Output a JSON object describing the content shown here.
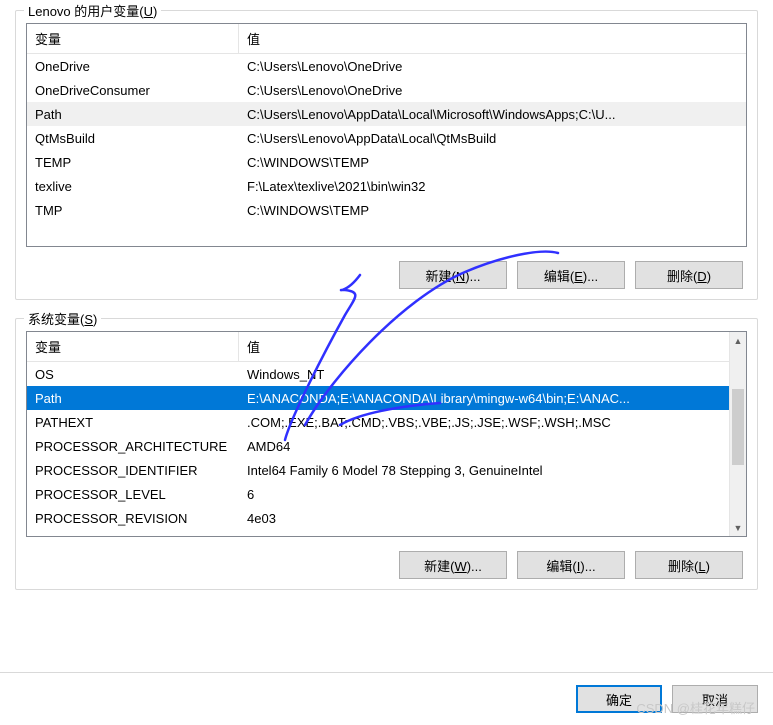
{
  "user_section": {
    "label_prefix": "Lenovo 的用户变量(",
    "label_key": "U",
    "label_suffix": ")",
    "headers": {
      "name": "变量",
      "value": "值"
    },
    "rows": [
      {
        "name": "OneDrive",
        "value": "C:\\Users\\Lenovo\\OneDrive",
        "selected": false
      },
      {
        "name": "OneDriveConsumer",
        "value": "C:\\Users\\Lenovo\\OneDrive",
        "selected": false
      },
      {
        "name": "Path",
        "value": "C:\\Users\\Lenovo\\AppData\\Local\\Microsoft\\WindowsApps;C:\\U...",
        "selected": "light"
      },
      {
        "name": "QtMsBuild",
        "value": "C:\\Users\\Lenovo\\AppData\\Local\\QtMsBuild",
        "selected": false
      },
      {
        "name": "TEMP",
        "value": "C:\\WINDOWS\\TEMP",
        "selected": false
      },
      {
        "name": "texlive",
        "value": "F:\\Latex\\texlive\\2021\\bin\\win32",
        "selected": false
      },
      {
        "name": "TMP",
        "value": "C:\\WINDOWS\\TEMP",
        "selected": false
      }
    ],
    "buttons": {
      "new": {
        "label": "新建(",
        "key": "N",
        "suffix": ")..."
      },
      "edit": {
        "label": "编辑(",
        "key": "E",
        "suffix": ")..."
      },
      "delete": {
        "label": "删除(",
        "key": "D",
        "suffix": ")"
      }
    }
  },
  "system_section": {
    "label_prefix": "系统变量(",
    "label_key": "S",
    "label_suffix": ")",
    "headers": {
      "name": "变量",
      "value": "值"
    },
    "rows": [
      {
        "name": "OS",
        "value": "Windows_NT",
        "selected": false
      },
      {
        "name": "Path",
        "value": "E:\\ANACONDA;E:\\ANACONDA\\Library\\mingw-w64\\bin;E:\\ANAC...",
        "selected": true
      },
      {
        "name": "PATHEXT",
        "value": ".COM;.EXE;.BAT;.CMD;.VBS;.VBE;.JS;.JSE;.WSF;.WSH;.MSC",
        "selected": false
      },
      {
        "name": "PROCESSOR_ARCHITECTURE",
        "value": "AMD64",
        "selected": false
      },
      {
        "name": "PROCESSOR_IDENTIFIER",
        "value": "Intel64 Family 6 Model 78 Stepping 3, GenuineIntel",
        "selected": false
      },
      {
        "name": "PROCESSOR_LEVEL",
        "value": "6",
        "selected": false
      },
      {
        "name": "PROCESSOR_REVISION",
        "value": "4e03",
        "selected": false
      }
    ],
    "buttons": {
      "new": {
        "label": "新建(",
        "key": "W",
        "suffix": ")..."
      },
      "edit": {
        "label": "编辑(",
        "key": "I",
        "suffix": ")..."
      },
      "delete": {
        "label": "删除(",
        "key": "L",
        "suffix": ")"
      }
    }
  },
  "footer": {
    "ok": "确定",
    "cancel": "取消"
  },
  "watermark": "CSDN @桂花年糕仔"
}
